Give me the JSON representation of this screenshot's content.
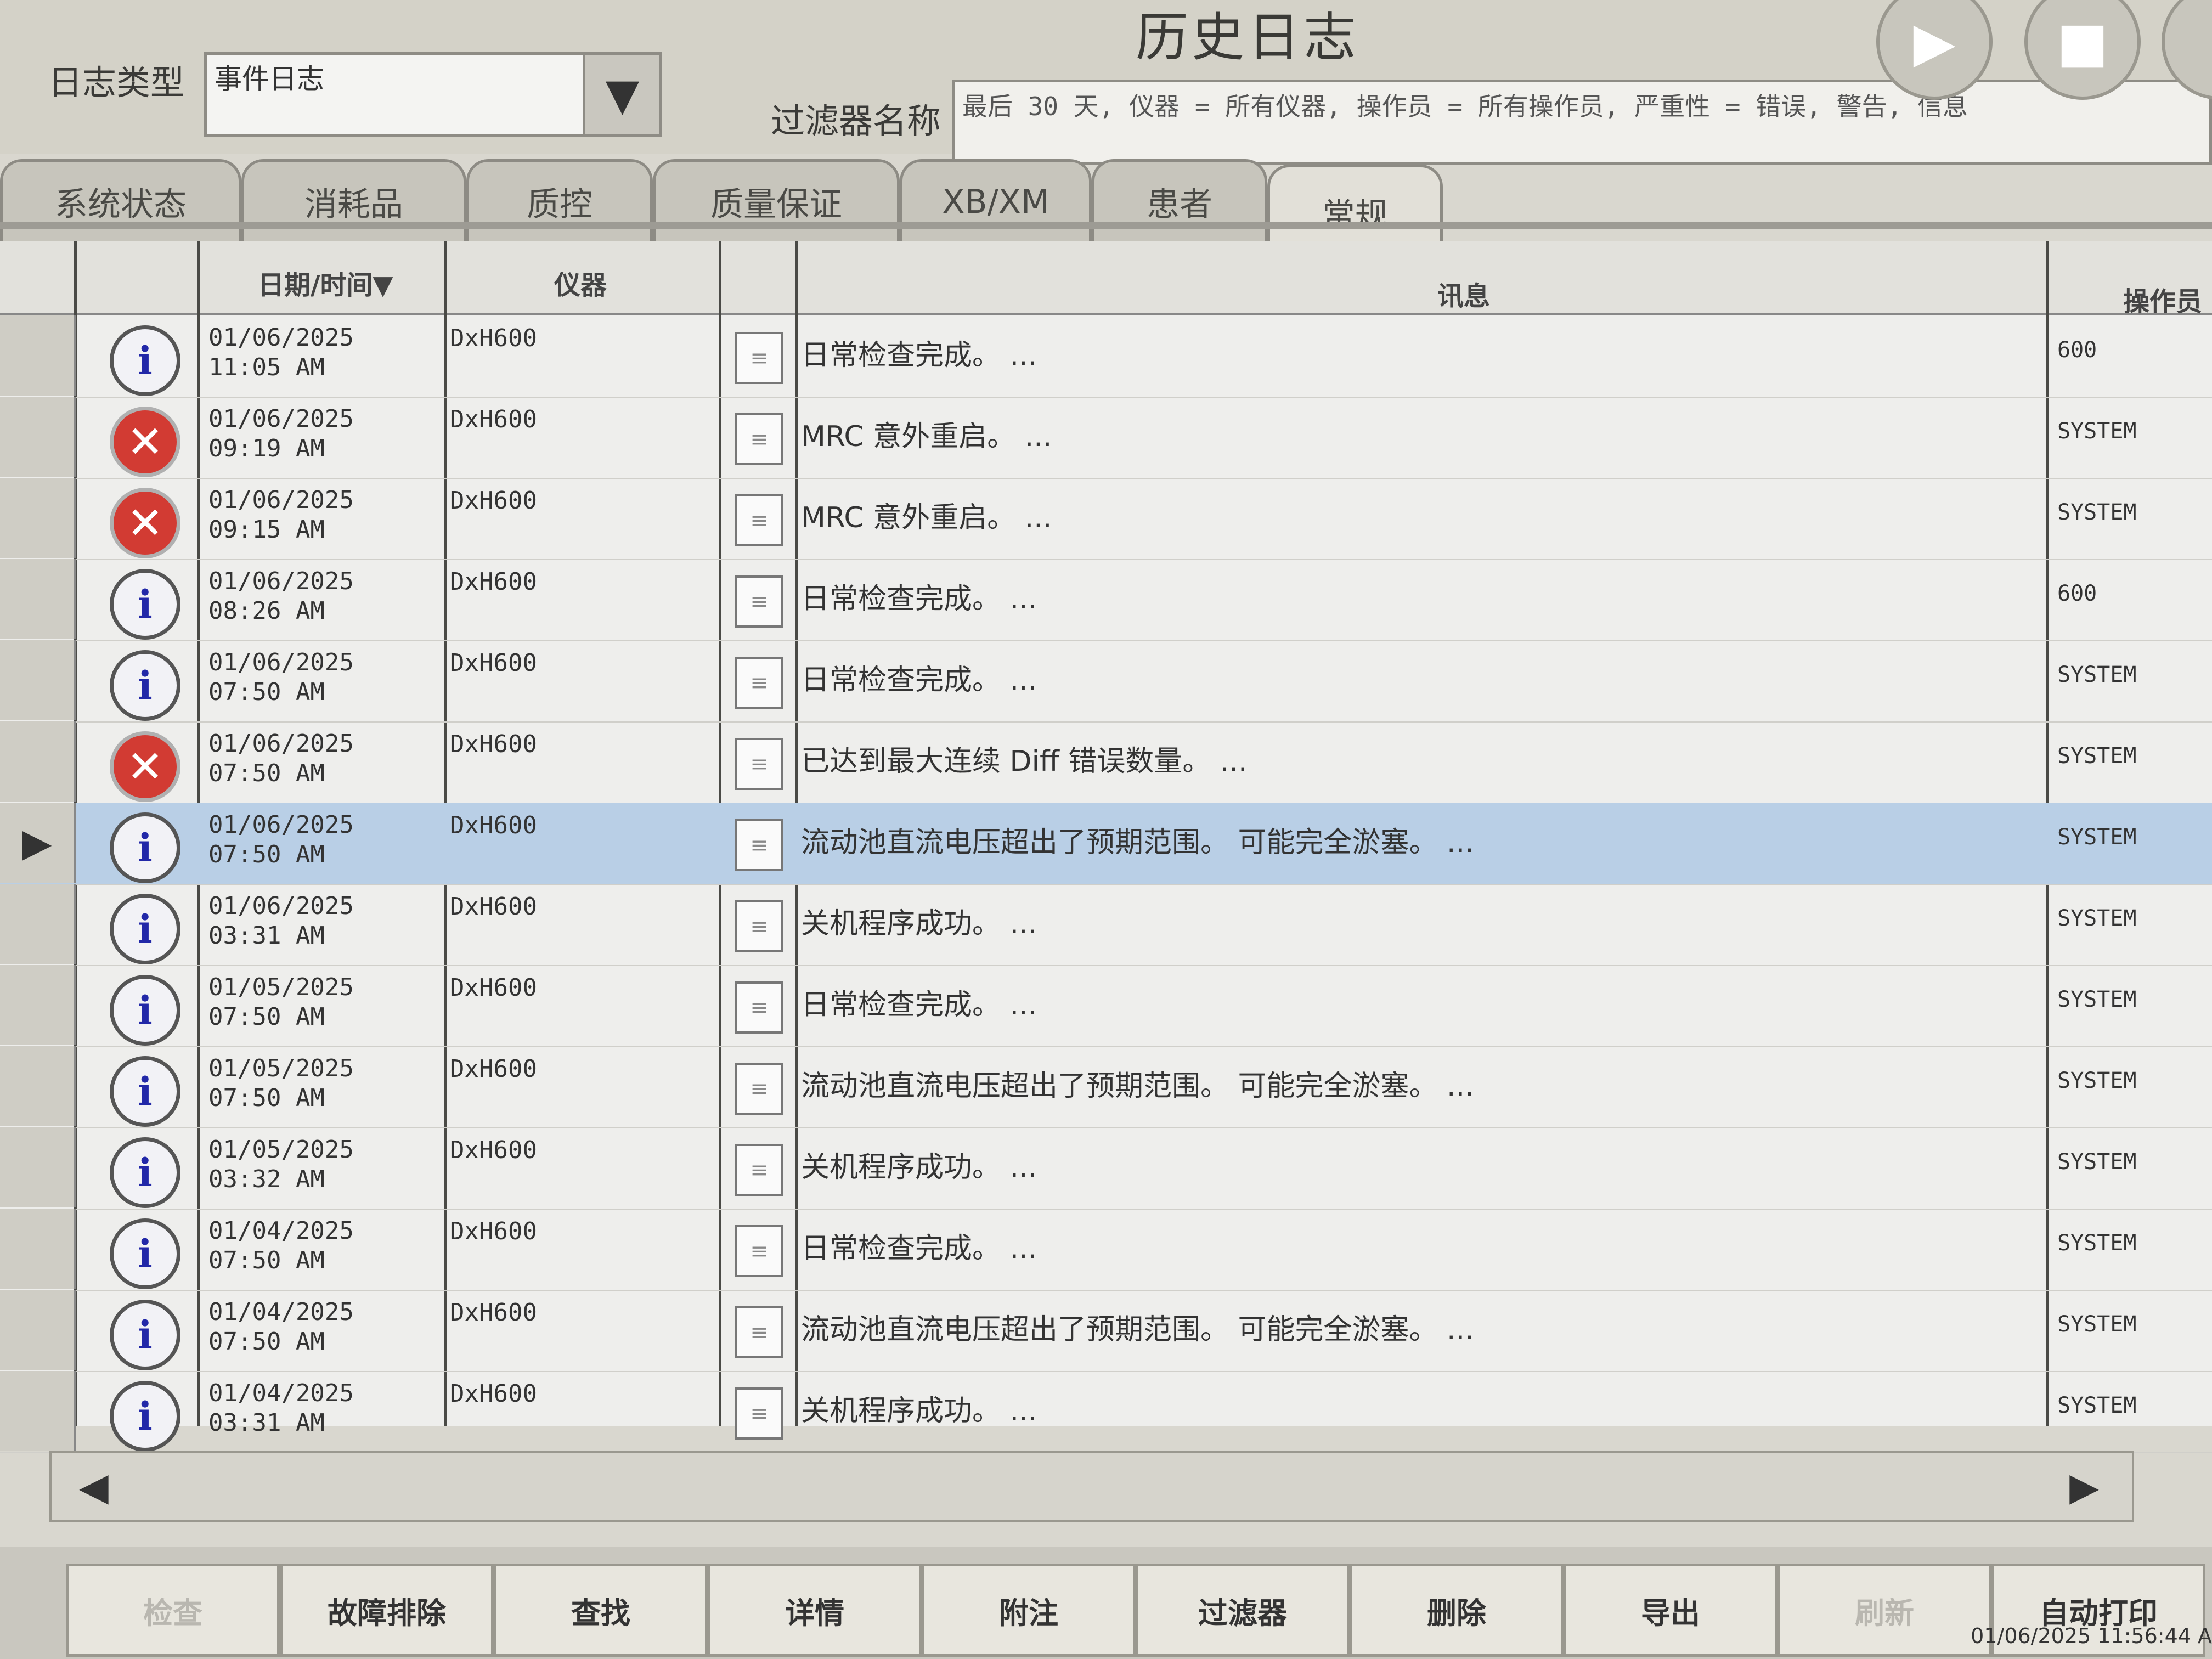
{
  "header": {
    "title": "历史日志",
    "log_type_label": "日志类型",
    "log_type_value": "事件日志",
    "filter_label": "过滤器名称",
    "filter_value": "最后 30 天, 仪器 = 所有仪器, 操作员 = 所有操作员, 严重性 = 错误, 警告, 信息"
  },
  "tabs": [
    {
      "label": "系统状态",
      "active": false
    },
    {
      "label": "消耗品",
      "active": false
    },
    {
      "label": "质控",
      "active": false
    },
    {
      "label": "质量保证",
      "active": false
    },
    {
      "label": "XB/XM",
      "active": false
    },
    {
      "label": "患者",
      "active": false
    },
    {
      "label": "常规",
      "active": true
    }
  ],
  "columns": {
    "datetime": "日期/时间▼",
    "instrument": "仪器",
    "message": "讯息",
    "operator": "操作员"
  },
  "rows": [
    {
      "severity": "info",
      "date": "01/06/2025",
      "time": "11:05 AM",
      "instrument": "DxH600",
      "message": "日常检查完成。 ...",
      "operator": "600"
    },
    {
      "severity": "error",
      "date": "01/06/2025",
      "time": "09:19 AM",
      "instrument": "DxH600",
      "message": "MRC 意外重启。 ...",
      "operator": "SYSTEM"
    },
    {
      "severity": "error",
      "date": "01/06/2025",
      "time": "09:15 AM",
      "instrument": "DxH600",
      "message": "MRC 意外重启。 ...",
      "operator": "SYSTEM"
    },
    {
      "severity": "info",
      "date": "01/06/2025",
      "time": "08:26 AM",
      "instrument": "DxH600",
      "message": "日常检查完成。 ...",
      "operator": "600"
    },
    {
      "severity": "info",
      "date": "01/06/2025",
      "time": "07:50 AM",
      "instrument": "DxH600",
      "message": "日常检查完成。 ...",
      "operator": "SYSTEM"
    },
    {
      "severity": "error",
      "date": "01/06/2025",
      "time": "07:50 AM",
      "instrument": "DxH600",
      "message": "已达到最大连续 Diff 错误数量。 ...",
      "operator": "SYSTEM"
    },
    {
      "severity": "info",
      "date": "01/06/2025",
      "time": "07:50 AM",
      "instrument": "DxH600",
      "message": "流动池直流电压超出了预期范围。 可能完全淤塞。 ...",
      "operator": "SYSTEM",
      "selected": true
    },
    {
      "severity": "info",
      "date": "01/06/2025",
      "time": "03:31 AM",
      "instrument": "DxH600",
      "message": "关机程序成功。 ...",
      "operator": "SYSTEM"
    },
    {
      "severity": "info",
      "date": "01/05/2025",
      "time": "07:50 AM",
      "instrument": "DxH600",
      "message": "日常检查完成。 ...",
      "operator": "SYSTEM"
    },
    {
      "severity": "info",
      "date": "01/05/2025",
      "time": "07:50 AM",
      "instrument": "DxH600",
      "message": "流动池直流电压超出了预期范围。 可能完全淤塞。 ...",
      "operator": "SYSTEM"
    },
    {
      "severity": "info",
      "date": "01/05/2025",
      "time": "03:32 AM",
      "instrument": "DxH600",
      "message": "关机程序成功。 ...",
      "operator": "SYSTEM"
    },
    {
      "severity": "info",
      "date": "01/04/2025",
      "time": "07:50 AM",
      "instrument": "DxH600",
      "message": "日常检查完成。 ...",
      "operator": "SYSTEM"
    },
    {
      "severity": "info",
      "date": "01/04/2025",
      "time": "07:50 AM",
      "instrument": "DxH600",
      "message": "流动池直流电压超出了预期范围。 可能完全淤塞。 ...",
      "operator": "SYSTEM"
    },
    {
      "severity": "info",
      "date": "01/04/2025",
      "time": "03:31 AM",
      "instrument": "DxH600",
      "message": "关机程序成功。 ...",
      "operator": "SYSTEM"
    }
  ],
  "buttons": [
    {
      "label": "检查",
      "enabled": false
    },
    {
      "label": "故障排除",
      "enabled": true
    },
    {
      "label": "查找",
      "enabled": true
    },
    {
      "label": "详情",
      "enabled": true
    },
    {
      "label": "附注",
      "enabled": true
    },
    {
      "label": "过滤器",
      "enabled": true
    },
    {
      "label": "删除",
      "enabled": true
    },
    {
      "label": "导出",
      "enabled": true
    },
    {
      "label": "刷新",
      "enabled": false
    },
    {
      "label": "自动打印",
      "enabled": true
    }
  ],
  "status": {
    "datetime": "01/06/2025 11:56:44 A"
  },
  "icons": {
    "info": "i",
    "error": "✕",
    "play": "▶",
    "stop": "■",
    "row_pointer": "▶",
    "dropdown": "▼",
    "scroll_left": "◀",
    "scroll_right": "▶",
    "note": "≡"
  },
  "colors": {
    "selected_row": "#b9cfe6",
    "error_icon": "#d23b33",
    "info_icon_letter": "#2228a8"
  }
}
